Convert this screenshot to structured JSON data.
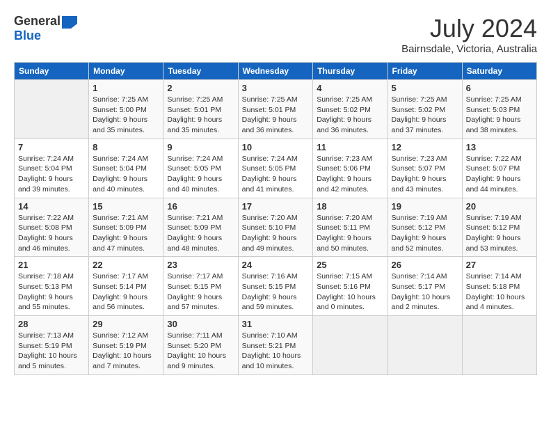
{
  "header": {
    "logo_general": "General",
    "logo_blue": "Blue",
    "month": "July 2024",
    "location": "Bairnsdale, Victoria, Australia"
  },
  "days_of_week": [
    "Sunday",
    "Monday",
    "Tuesday",
    "Wednesday",
    "Thursday",
    "Friday",
    "Saturday"
  ],
  "weeks": [
    [
      {
        "day": "",
        "sunrise": "",
        "sunset": "",
        "daylight": ""
      },
      {
        "day": "1",
        "sunrise": "Sunrise: 7:25 AM",
        "sunset": "Sunset: 5:00 PM",
        "daylight": "Daylight: 9 hours and 35 minutes."
      },
      {
        "day": "2",
        "sunrise": "Sunrise: 7:25 AM",
        "sunset": "Sunset: 5:01 PM",
        "daylight": "Daylight: 9 hours and 35 minutes."
      },
      {
        "day": "3",
        "sunrise": "Sunrise: 7:25 AM",
        "sunset": "Sunset: 5:01 PM",
        "daylight": "Daylight: 9 hours and 36 minutes."
      },
      {
        "day": "4",
        "sunrise": "Sunrise: 7:25 AM",
        "sunset": "Sunset: 5:02 PM",
        "daylight": "Daylight: 9 hours and 36 minutes."
      },
      {
        "day": "5",
        "sunrise": "Sunrise: 7:25 AM",
        "sunset": "Sunset: 5:02 PM",
        "daylight": "Daylight: 9 hours and 37 minutes."
      },
      {
        "day": "6",
        "sunrise": "Sunrise: 7:25 AM",
        "sunset": "Sunset: 5:03 PM",
        "daylight": "Daylight: 9 hours and 38 minutes."
      }
    ],
    [
      {
        "day": "7",
        "sunrise": "Sunrise: 7:24 AM",
        "sunset": "Sunset: 5:04 PM",
        "daylight": "Daylight: 9 hours and 39 minutes."
      },
      {
        "day": "8",
        "sunrise": "Sunrise: 7:24 AM",
        "sunset": "Sunset: 5:04 PM",
        "daylight": "Daylight: 9 hours and 40 minutes."
      },
      {
        "day": "9",
        "sunrise": "Sunrise: 7:24 AM",
        "sunset": "Sunset: 5:05 PM",
        "daylight": "Daylight: 9 hours and 40 minutes."
      },
      {
        "day": "10",
        "sunrise": "Sunrise: 7:24 AM",
        "sunset": "Sunset: 5:05 PM",
        "daylight": "Daylight: 9 hours and 41 minutes."
      },
      {
        "day": "11",
        "sunrise": "Sunrise: 7:23 AM",
        "sunset": "Sunset: 5:06 PM",
        "daylight": "Daylight: 9 hours and 42 minutes."
      },
      {
        "day": "12",
        "sunrise": "Sunrise: 7:23 AM",
        "sunset": "Sunset: 5:07 PM",
        "daylight": "Daylight: 9 hours and 43 minutes."
      },
      {
        "day": "13",
        "sunrise": "Sunrise: 7:22 AM",
        "sunset": "Sunset: 5:07 PM",
        "daylight": "Daylight: 9 hours and 44 minutes."
      }
    ],
    [
      {
        "day": "14",
        "sunrise": "Sunrise: 7:22 AM",
        "sunset": "Sunset: 5:08 PM",
        "daylight": "Daylight: 9 hours and 46 minutes."
      },
      {
        "day": "15",
        "sunrise": "Sunrise: 7:21 AM",
        "sunset": "Sunset: 5:09 PM",
        "daylight": "Daylight: 9 hours and 47 minutes."
      },
      {
        "day": "16",
        "sunrise": "Sunrise: 7:21 AM",
        "sunset": "Sunset: 5:09 PM",
        "daylight": "Daylight: 9 hours and 48 minutes."
      },
      {
        "day": "17",
        "sunrise": "Sunrise: 7:20 AM",
        "sunset": "Sunset: 5:10 PM",
        "daylight": "Daylight: 9 hours and 49 minutes."
      },
      {
        "day": "18",
        "sunrise": "Sunrise: 7:20 AM",
        "sunset": "Sunset: 5:11 PM",
        "daylight": "Daylight: 9 hours and 50 minutes."
      },
      {
        "day": "19",
        "sunrise": "Sunrise: 7:19 AM",
        "sunset": "Sunset: 5:12 PM",
        "daylight": "Daylight: 9 hours and 52 minutes."
      },
      {
        "day": "20",
        "sunrise": "Sunrise: 7:19 AM",
        "sunset": "Sunset: 5:12 PM",
        "daylight": "Daylight: 9 hours and 53 minutes."
      }
    ],
    [
      {
        "day": "21",
        "sunrise": "Sunrise: 7:18 AM",
        "sunset": "Sunset: 5:13 PM",
        "daylight": "Daylight: 9 hours and 55 minutes."
      },
      {
        "day": "22",
        "sunrise": "Sunrise: 7:17 AM",
        "sunset": "Sunset: 5:14 PM",
        "daylight": "Daylight: 9 hours and 56 minutes."
      },
      {
        "day": "23",
        "sunrise": "Sunrise: 7:17 AM",
        "sunset": "Sunset: 5:15 PM",
        "daylight": "Daylight: 9 hours and 57 minutes."
      },
      {
        "day": "24",
        "sunrise": "Sunrise: 7:16 AM",
        "sunset": "Sunset: 5:15 PM",
        "daylight": "Daylight: 9 hours and 59 minutes."
      },
      {
        "day": "25",
        "sunrise": "Sunrise: 7:15 AM",
        "sunset": "Sunset: 5:16 PM",
        "daylight": "Daylight: 10 hours and 0 minutes."
      },
      {
        "day": "26",
        "sunrise": "Sunrise: 7:14 AM",
        "sunset": "Sunset: 5:17 PM",
        "daylight": "Daylight: 10 hours and 2 minutes."
      },
      {
        "day": "27",
        "sunrise": "Sunrise: 7:14 AM",
        "sunset": "Sunset: 5:18 PM",
        "daylight": "Daylight: 10 hours and 4 minutes."
      }
    ],
    [
      {
        "day": "28",
        "sunrise": "Sunrise: 7:13 AM",
        "sunset": "Sunset: 5:19 PM",
        "daylight": "Daylight: 10 hours and 5 minutes."
      },
      {
        "day": "29",
        "sunrise": "Sunrise: 7:12 AM",
        "sunset": "Sunset: 5:19 PM",
        "daylight": "Daylight: 10 hours and 7 minutes."
      },
      {
        "day": "30",
        "sunrise": "Sunrise: 7:11 AM",
        "sunset": "Sunset: 5:20 PM",
        "daylight": "Daylight: 10 hours and 9 minutes."
      },
      {
        "day": "31",
        "sunrise": "Sunrise: 7:10 AM",
        "sunset": "Sunset: 5:21 PM",
        "daylight": "Daylight: 10 hours and 10 minutes."
      },
      {
        "day": "",
        "sunrise": "",
        "sunset": "",
        "daylight": ""
      },
      {
        "day": "",
        "sunrise": "",
        "sunset": "",
        "daylight": ""
      },
      {
        "day": "",
        "sunrise": "",
        "sunset": "",
        "daylight": ""
      }
    ]
  ]
}
